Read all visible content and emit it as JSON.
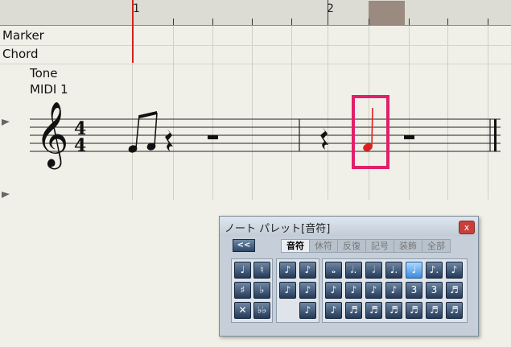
{
  "ruler": {
    "measure_1": "1",
    "measure_2": "2"
  },
  "tracks": {
    "marker": "Marker",
    "chord": "Chord",
    "tone": "Tone",
    "midi": "MIDI 1"
  },
  "palette": {
    "title": "ノート パレット[音符]",
    "close": "x",
    "back": "<<",
    "tabs": [
      "音符",
      "休符",
      "反復",
      "記号",
      "装飾",
      "全部"
    ],
    "active_tab": "音符",
    "accidentals": [
      "♩",
      "♮",
      "♯",
      "♭",
      "✕",
      "♭♭"
    ],
    "grace": [
      "♪",
      "♪",
      "♪",
      "♪",
      "♪"
    ],
    "notes_row1": [
      "𝅝",
      "𝅗𝅥.",
      "𝅗𝅥",
      "♩.",
      "♩",
      "♪.",
      "♪"
    ],
    "notes_row2": [
      "♪",
      "♪",
      "♪",
      "♪",
      "3",
      "3",
      "♬"
    ],
    "notes_row3": [
      "♪",
      "♬",
      "♬",
      "♬",
      "♬",
      "♬",
      "♬"
    ],
    "selected_note": "♩"
  },
  "colors": {
    "cursor": "#d02020",
    "highlight": "#e0206a",
    "red_note": "#e02020",
    "ruler_selection": "#9a8a80"
  }
}
